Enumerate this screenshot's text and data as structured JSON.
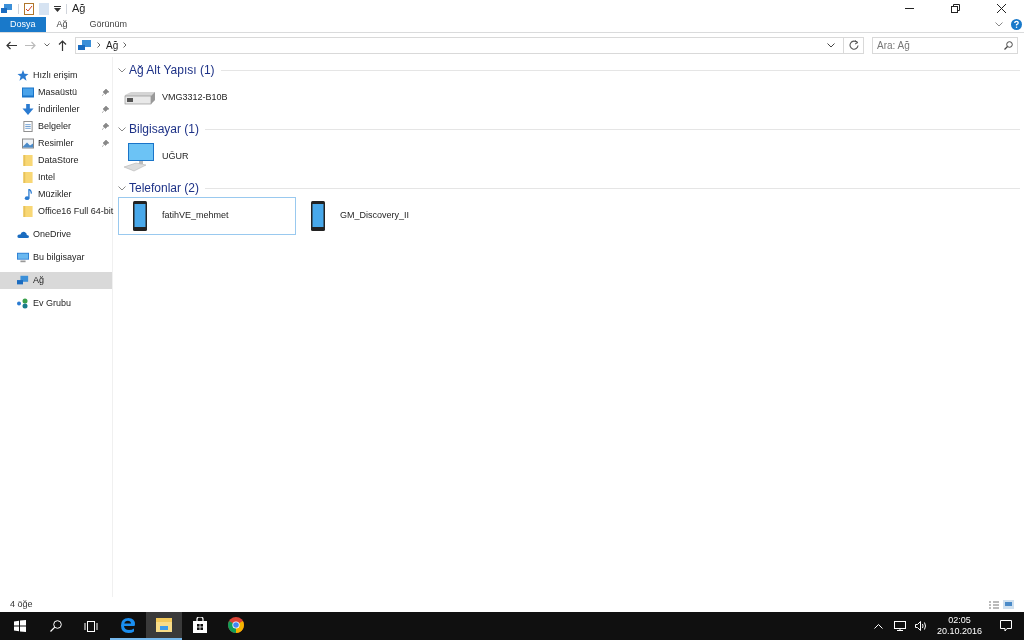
{
  "window": {
    "title": "Ağ"
  },
  "ribbon_tabs": [
    {
      "label": "Dosya",
      "selected": true
    },
    {
      "label": "Ağ",
      "selected": false
    },
    {
      "label": "Görünüm",
      "selected": false
    }
  ],
  "address": {
    "path": [
      "Ağ"
    ]
  },
  "search": {
    "placeholder": "Ara: Ağ"
  },
  "sidebar": {
    "items": [
      {
        "label": "Hızlı erişim",
        "kind": "star",
        "pinned": false,
        "selected": false,
        "children": [
          {
            "label": "Masaüstü",
            "kind": "desktop",
            "pinned": true,
            "selected": false
          },
          {
            "label": "İndirilenler",
            "kind": "download",
            "pinned": true,
            "selected": false
          },
          {
            "label": "Belgeler",
            "kind": "document",
            "pinned": true,
            "selected": false
          },
          {
            "label": "Resimler",
            "kind": "picture",
            "pinned": true,
            "selected": false
          },
          {
            "label": "DataStore",
            "kind": "folder",
            "pinned": false,
            "selected": false
          },
          {
            "label": "Intel",
            "kind": "folder",
            "pinned": false,
            "selected": false
          },
          {
            "label": "Müzikler",
            "kind": "music",
            "pinned": false,
            "selected": false
          },
          {
            "label": "Office16 Full 64-bit",
            "kind": "folder",
            "pinned": false,
            "selected": false
          }
        ]
      },
      {
        "label": "OneDrive",
        "kind": "cloud",
        "pinned": false,
        "selected": false
      },
      {
        "label": "Bu bilgisayar",
        "kind": "computer",
        "pinned": false,
        "selected": false
      },
      {
        "label": "Ağ",
        "kind": "network",
        "pinned": false,
        "selected": true
      },
      {
        "label": "Ev Grubu",
        "kind": "homegroup",
        "pinned": false,
        "selected": false
      }
    ]
  },
  "groups": [
    {
      "title": "Ağ Alt Yapısı (1)",
      "expanded": true,
      "items": [
        {
          "name": "VMG3312-B10B",
          "kind": "router",
          "selected": false
        }
      ]
    },
    {
      "title": "Bilgisayar (1)",
      "expanded": true,
      "items": [
        {
          "name": "UĞUR",
          "kind": "computer",
          "selected": false
        }
      ]
    },
    {
      "title": "Telefonlar (2)",
      "expanded": true,
      "items": [
        {
          "name": "fatihVE_mehmet",
          "kind": "phone",
          "selected": true
        },
        {
          "name": "GM_Discovery_II",
          "kind": "phone",
          "selected": false
        }
      ]
    }
  ],
  "status_bar": {
    "count": "4 öğe"
  },
  "taskbar": {
    "apps": [
      {
        "kind": "edge",
        "running": true,
        "selected": false
      },
      {
        "kind": "explorer",
        "running": true,
        "selected": true
      },
      {
        "kind": "store",
        "running": false,
        "selected": false
      },
      {
        "kind": "chrome",
        "running": false,
        "selected": false
      }
    ],
    "time": "02:05",
    "date": "20.10.2016"
  }
}
